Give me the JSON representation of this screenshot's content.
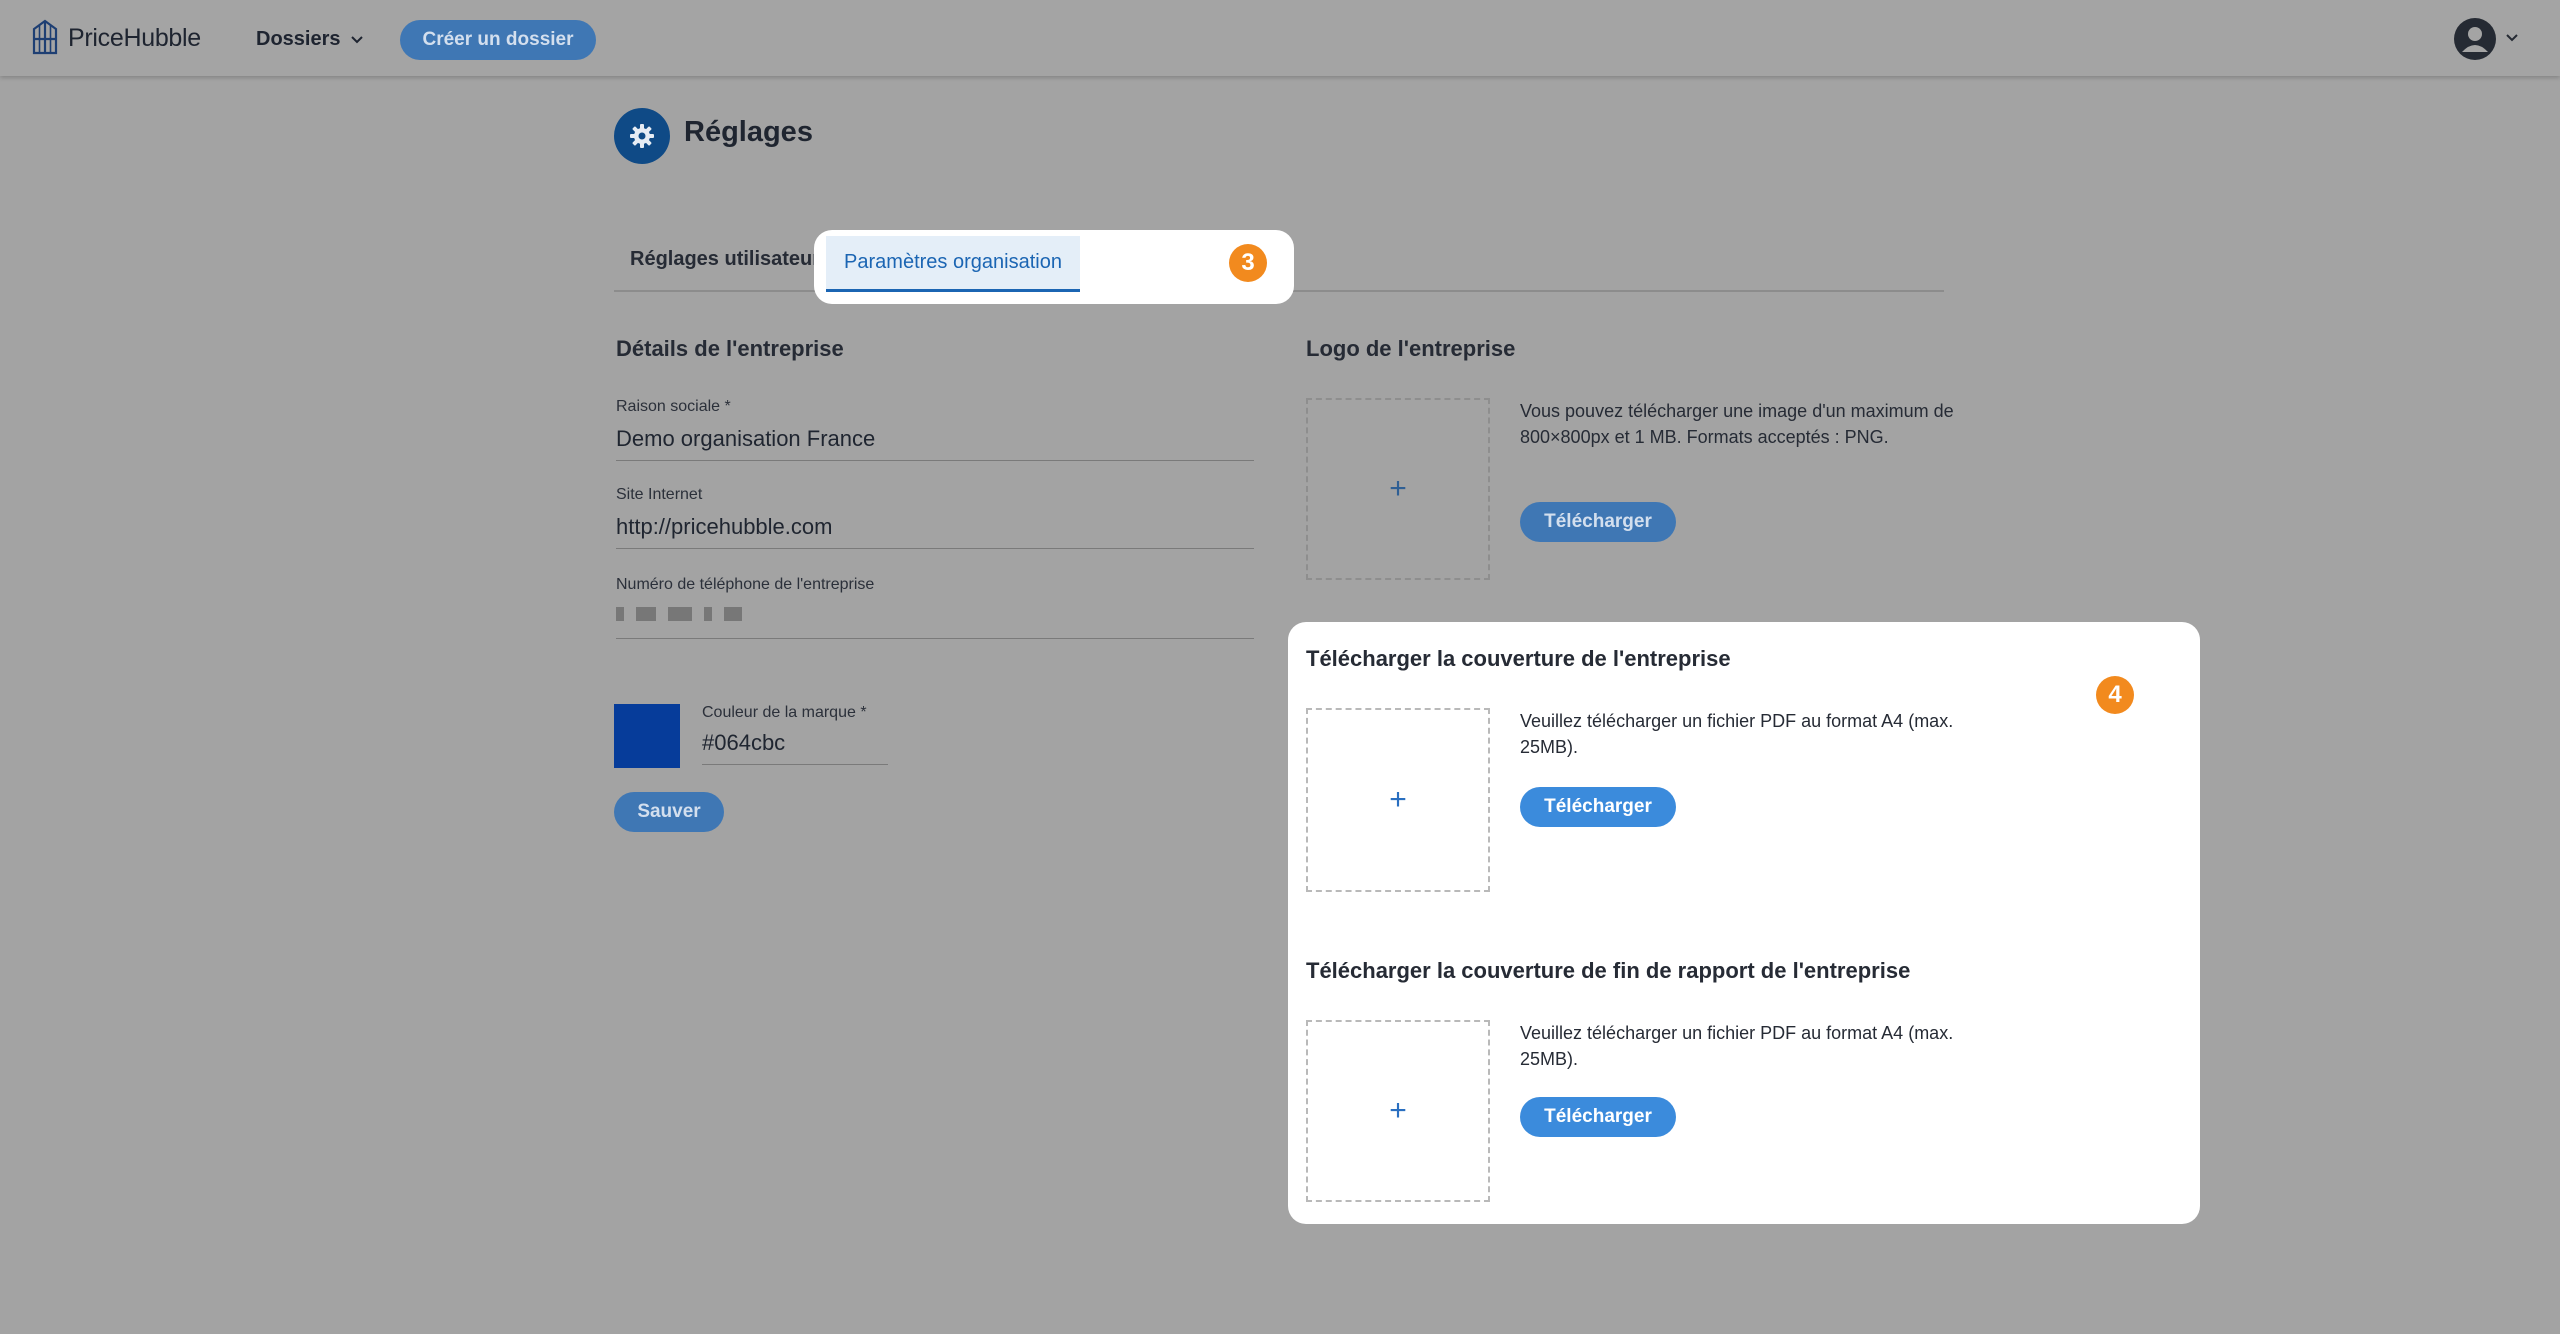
{
  "app": {
    "brand": "PriceHubble",
    "nav_dossiers": "Dossiers",
    "create_button": "Créer un dossier"
  },
  "page": {
    "title": "Réglages"
  },
  "tabs": [
    {
      "label": "Réglages utilisateur",
      "active": false
    },
    {
      "label": "Paramètres organisation",
      "active": true
    }
  ],
  "badges": {
    "tabs": "3",
    "uploads": "4"
  },
  "company": {
    "section_title": "Détails de l'entreprise",
    "name_label": "Raison sociale *",
    "name_value": "Demo organisation France",
    "website_label": "Site Internet",
    "website_value": "http://pricehubble.com",
    "phone_label": "Numéro de téléphone de l'entreprise",
    "brand_color_label": "Couleur de la marque *",
    "brand_color_value": "#064cbc",
    "save_label": "Sauver"
  },
  "logo": {
    "section_title": "Logo de l'entreprise",
    "description": "Vous pouvez télécharger une image d'un maximum de 800×800px et 1 MB. Formats acceptés : PNG.",
    "upload_label": "Télécharger"
  },
  "cover": {
    "section_title": "Télécharger la couverture de l'entreprise",
    "description": "Veuillez télécharger un fichier PDF au format A4 (max. 25MB).",
    "upload_label": "Télécharger"
  },
  "end_cover": {
    "section_title": "Télécharger la couverture de fin de rapport de l'entreprise",
    "description": "Veuillez télécharger un fichier PDF au format A4 (max. 25MB).",
    "upload_label": "Télécharger"
  },
  "colors": {
    "primary": "#3b8bdc",
    "accent_badge": "#f28a1e",
    "brand_swatch": "#063c9a"
  }
}
